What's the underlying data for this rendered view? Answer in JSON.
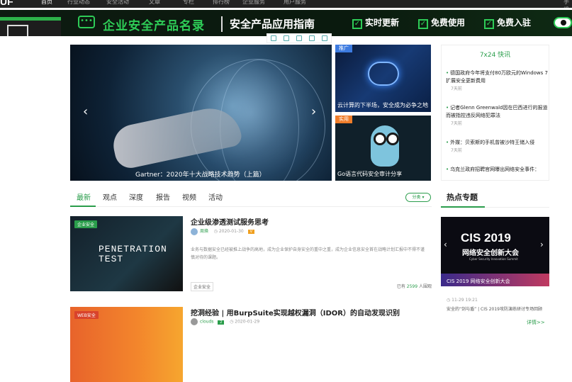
{
  "nav": {
    "logo": "UF",
    "items": [
      "首页",
      "行业动态",
      "安全活动",
      "文章",
      "专栏",
      "排行榜",
      "企业服务",
      "用户服务",
      "手机"
    ]
  },
  "banner": {
    "title": "企业安全产品名录",
    "subtitle": "安全产品应用指南",
    "features": [
      "实时更新",
      "免费使用",
      "免费入驻"
    ]
  },
  "hero": {
    "caption": "Gartner：2020年十大战略技术趋势（上篇）",
    "prev_icon": "‹",
    "next_icon": "›"
  },
  "side_cards": [
    {
      "tag": "推广",
      "caption": "云计算的下半场，安全成为必争之地"
    },
    {
      "tag": "实用",
      "caption": "Go语言代码安全审计分享"
    }
  ],
  "kuaixun": {
    "title": "7x24 快讯",
    "entries": [
      {
        "text": "德国政府今年将支付80万欧元的Windows 7 扩展安全更新费用",
        "time": "7天前"
      },
      {
        "text": "记者Glenn Greenwald因在巴西进行的报道而被指控违反网络犯罪法",
        "time": "7天前"
      },
      {
        "text": "外媒：贝索斯的手机曾被沙特王储入侵",
        "time": "7天前"
      },
      {
        "text": "乌克兰政府招聘官网曝出网络安全事件：",
        "time": ""
      }
    ]
  },
  "tabs": {
    "items": [
      "最新",
      "观点",
      "深度",
      "报告",
      "视频",
      "活动"
    ],
    "filter": "分类 ▾"
  },
  "hot": {
    "title": "热点专题",
    "banner_big": "CIS 2019",
    "banner_cn": "网络安全创新大会",
    "banner_en": "Cyber Security Innovation Summit",
    "banner_caption": "CIS 2019 网络安全创新大会",
    "date": "11-29 19:21",
    "desc": "安全的“剑与盾” | CIS 2019攻防演练研讨专场回顾",
    "more": "详情>>"
  },
  "articles": [
    {
      "badge": "企业安全",
      "thumb_text": "PENETRATION TEST",
      "title": "企业级渗透测试服务思考",
      "author": "周焕",
      "date": "2020-01-30",
      "level": "V",
      "excerpt": "业务与数据安全已经被推上战争的高地，成为企业保护自身安全的重中之重，成为企业信息安全首在战略计划汇报中不得不谨慎对待的课题。",
      "category": "企业安全",
      "views_prefix": "已有",
      "views": "2599",
      "views_suffix": "人围观"
    },
    {
      "badge": "WEB安全",
      "title": "挖洞经验 | 用BurpSuite实现越权漏洞（IDOR）的自动发现识别",
      "author": "clouds",
      "date": "2020-01-29",
      "level": "2"
    }
  ]
}
